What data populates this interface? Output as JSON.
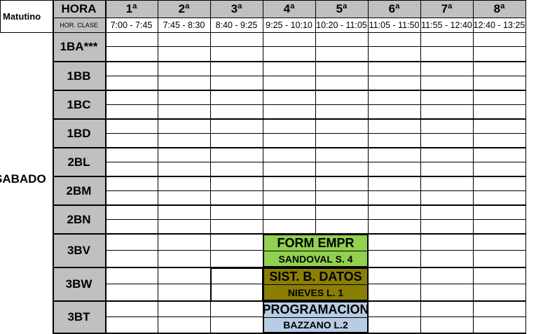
{
  "shift_label": "Matutino",
  "hora_label": "HORA",
  "hor_clase_label": "HOR. CLASE",
  "day_label": "SABADO",
  "periods": [
    "1ª",
    "2ª",
    "3ª",
    "4ª",
    "5ª",
    "6ª",
    "7ª",
    "8ª"
  ],
  "times": [
    "7:00 - 7:45",
    "7:45 - 8:30",
    "8:40 - 9:25",
    "9:25 - 10:10",
    "10:20 - 11:05",
    "11:05 - 11:50",
    "11:55 - 12:40",
    "12:40 - 13:25"
  ],
  "groups": [
    "1BA***",
    "1BB",
    "1BC",
    "1BD",
    "2BL",
    "2BM",
    "2BN",
    "3BV",
    "3BW",
    "3BT"
  ],
  "classes": [
    {
      "subject": "FORM EMPR",
      "teacher": "SANDOVAL  S. 4",
      "subject_color": "#92d050",
      "teacher_color": "#92d050"
    },
    {
      "subject": "SIST. B. DATOS",
      "teacher": "NIEVES  L. 1",
      "subject_color": "#8b7e05",
      "teacher_color": "#8b7e05"
    },
    {
      "subject": "PROGRAMACION",
      "teacher": "BAZZANO  L.2",
      "subject_color": "#b8cce4",
      "teacher_color": "#b8cce4"
    }
  ]
}
